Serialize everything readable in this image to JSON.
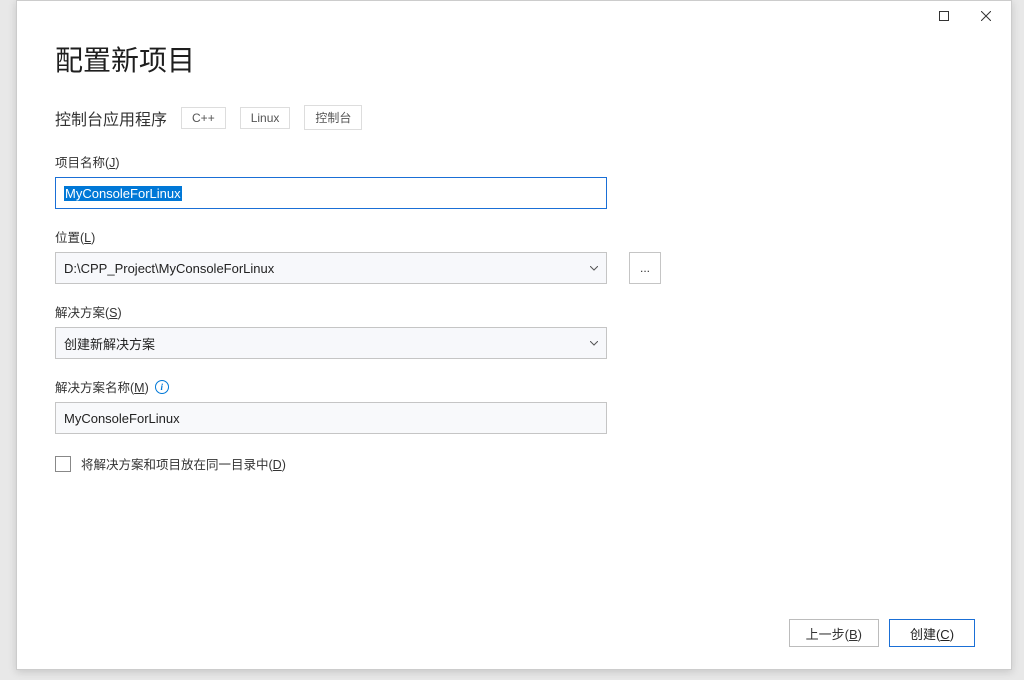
{
  "titlebar": {
    "maximize_aria": "Maximize",
    "close_aria": "Close"
  },
  "header": {
    "title": "配置新项目",
    "subtitle": "控制台应用程序",
    "tags": [
      "C++",
      "Linux",
      "控制台"
    ]
  },
  "fields": {
    "project_name": {
      "label_prefix": "项目名称(",
      "label_key": "J",
      "label_suffix": ")",
      "value": "MyConsoleForLinux"
    },
    "location": {
      "label_prefix": "位置(",
      "label_key": "L",
      "label_suffix": ")",
      "value": "D:\\CPP_Project\\MyConsoleForLinux",
      "browse_label": "..."
    },
    "solution": {
      "label_prefix": "解决方案(",
      "label_key": "S",
      "label_suffix": ")",
      "value": "创建新解决方案"
    },
    "solution_name": {
      "label_prefix": "解决方案名称(",
      "label_key": "M",
      "label_suffix": ")",
      "info_glyph": "i",
      "value": "MyConsoleForLinux"
    },
    "same_dir_checkbox": {
      "label_prefix": "将解决方案和项目放在同一目录中(",
      "label_key": "D",
      "label_suffix": ")"
    }
  },
  "footer": {
    "back_prefix": "上一步(",
    "back_key": "B",
    "back_suffix": ")",
    "create_prefix": "创建(",
    "create_key": "C",
    "create_suffix": ")"
  }
}
